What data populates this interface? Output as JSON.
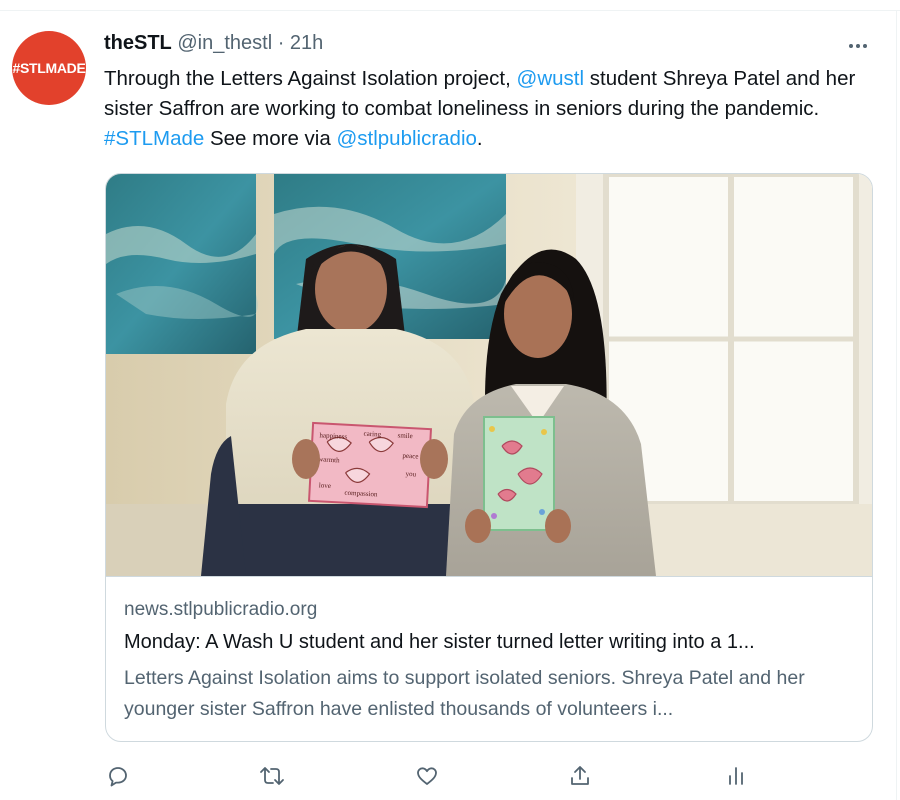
{
  "tweet": {
    "avatar_text": "#STLMADE",
    "display_name": "theSTL",
    "handle": "@in_thestl",
    "separator": " · ",
    "time": "21h",
    "text": {
      "p1": "Through the Letters Against Isolation project, ",
      "mention1": "@wustl",
      "p2": " student Shreya Patel and her sister Saffron are working to combat loneliness in seniors during the pandemic. ",
      "hashtag": "#STLMade",
      "p3": " See more via ",
      "mention2": "@stlpublicradio",
      "p4": "."
    }
  },
  "card": {
    "image_alt": "Two sisters smiling and holding handmade cards",
    "card1_words": [
      "happiness",
      "caring",
      "smile",
      "peace",
      "you",
      "compassion",
      "love",
      "warmth"
    ],
    "domain": "news.stlpublicradio.org",
    "title": "Monday: A Wash U student and her sister turned letter writing into a 1...",
    "description": "Letters Against Isolation aims to support isolated seniors. Shreya Patel and her younger sister Saffron have enlisted thousands of volunteers i..."
  },
  "actions": {
    "reply_icon": "reply-icon",
    "retweet_icon": "retweet-icon",
    "like_icon": "heart-icon",
    "share_icon": "share-icon",
    "analytics_icon": "analytics-icon"
  },
  "colors": {
    "accent": "#1d9bf0",
    "avatar_bg": "#e2412c",
    "secondary_text": "#536471",
    "border": "#cfd9de"
  }
}
